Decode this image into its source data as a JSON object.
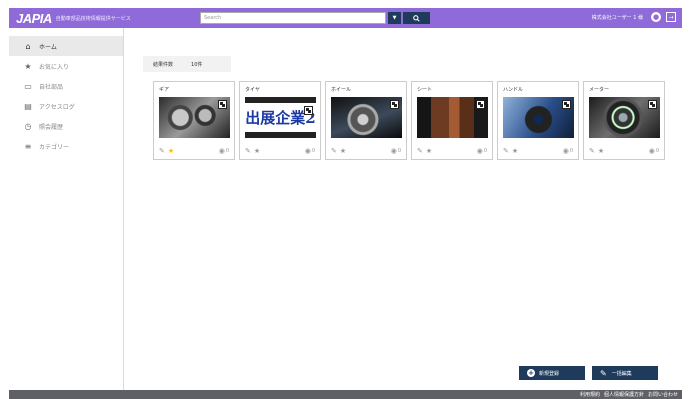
{
  "header": {
    "logo": "JAPIA",
    "logo_sub": "自動車部品技術情報提供サービス",
    "search_placeholder": "Search",
    "dropdown_icon": "▼",
    "user_label": "株式会社ユーザー 1 様",
    "icons": {
      "search": "search-icon",
      "user": "user-icon",
      "logout": "logout-icon"
    }
  },
  "sidebar": {
    "items": [
      {
        "label": "ホーム",
        "icon": "home-icon",
        "active": true
      },
      {
        "label": "お気に入り",
        "icon": "star-icon",
        "active": false
      },
      {
        "label": "自社部品",
        "icon": "monitor-icon",
        "active": false
      },
      {
        "label": "アクセスログ",
        "icon": "document-icon",
        "active": false
      },
      {
        "label": "照会履歴",
        "icon": "history-icon",
        "active": false
      },
      {
        "label": "カテゴリー",
        "icon": "list-icon",
        "active": false
      }
    ]
  },
  "results": {
    "label": "結果件数",
    "count": "10件"
  },
  "cards": [
    {
      "title": "ギア",
      "favorite": true,
      "views": "0"
    },
    {
      "title": "タイヤ",
      "image_text": "出展企業2",
      "favorite": false,
      "views": "0"
    },
    {
      "title": "ホイール",
      "favorite": false,
      "views": "0"
    },
    {
      "title": "シート",
      "favorite": false,
      "views": "0"
    },
    {
      "title": "ハンドル",
      "favorite": false,
      "views": "0"
    },
    {
      "title": "メーター",
      "favorite": false,
      "views": "0"
    }
  ],
  "buttons": {
    "new_label": "新規登録",
    "bulk_edit_label": "一括編集"
  },
  "footer": {
    "links": [
      "利用規約",
      "個人情報保護方針",
      "お問い合わせ"
    ]
  },
  "colors": {
    "header": "#8e6bd8",
    "dark_button": "#1f3b5c",
    "footer": "#5f6066",
    "favorite_star": "#f2c200"
  }
}
